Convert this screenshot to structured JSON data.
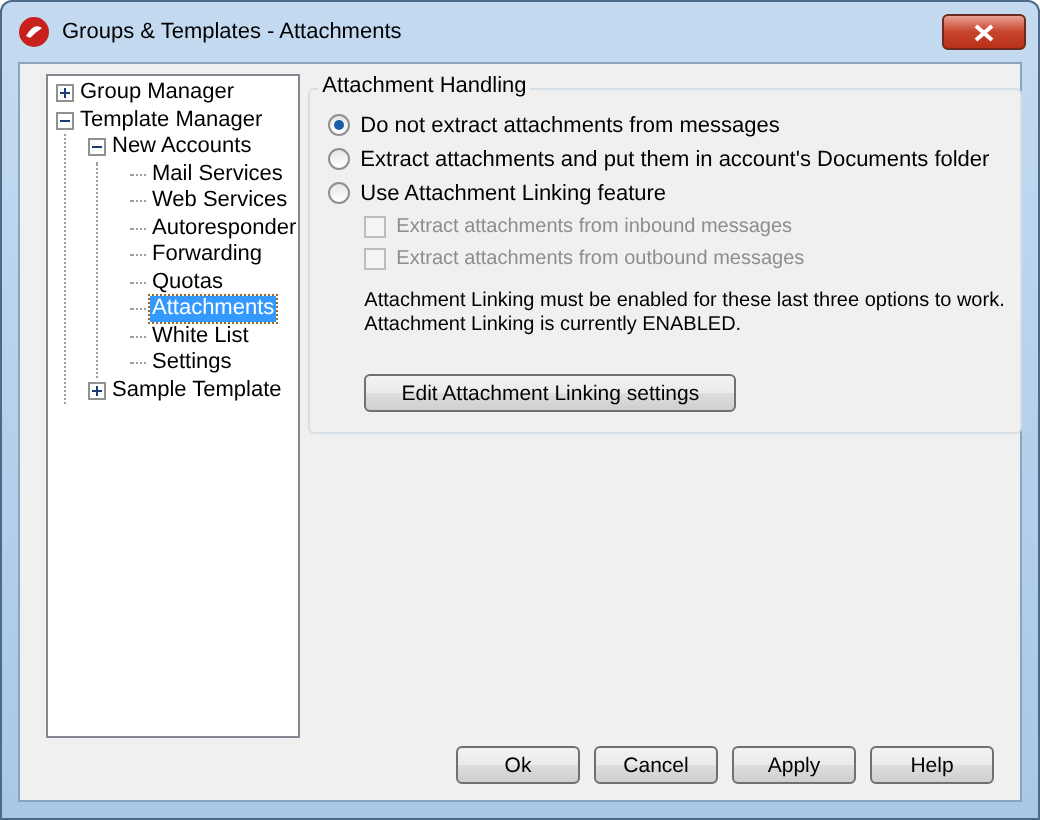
{
  "window": {
    "title": "Groups & Templates - Attachments"
  },
  "tree": [
    {
      "label": "Group Manager",
      "expanded": false,
      "selected": false
    },
    {
      "label": "Template Manager",
      "expanded": true,
      "selected": false,
      "children": [
        {
          "label": "New Accounts",
          "expanded": true,
          "selected": false,
          "children": [
            {
              "label": "Mail Services",
              "selected": false
            },
            {
              "label": "Web Services",
              "selected": false
            },
            {
              "label": "Autoresponder",
              "selected": false
            },
            {
              "label": "Forwarding",
              "selected": false
            },
            {
              "label": "Quotas",
              "selected": false
            },
            {
              "label": "Attachments",
              "selected": true
            },
            {
              "label": "White List",
              "selected": false
            },
            {
              "label": "Settings",
              "selected": false
            }
          ]
        },
        {
          "label": "Sample Template",
          "expanded": false,
          "selected": false
        }
      ]
    }
  ],
  "group": {
    "title": "Attachment Handling",
    "options": [
      {
        "label": "Do not extract attachments from messages",
        "selected": true
      },
      {
        "label": "Extract attachments and put them in account's Documents folder",
        "selected": false
      },
      {
        "label": "Use Attachment Linking feature",
        "selected": false
      }
    ],
    "checkboxes": [
      {
        "label": "Extract attachments from inbound messages",
        "checked": false,
        "disabled": true
      },
      {
        "label": "Extract attachments from outbound messages",
        "checked": false,
        "disabled": true
      }
    ],
    "note": [
      "Attachment Linking must be enabled for these last three options to work.",
      "Attachment Linking is currently ENABLED."
    ],
    "button": "Edit Attachment Linking settings"
  },
  "buttons": [
    "Ok",
    "Cancel",
    "Apply",
    "Help"
  ]
}
